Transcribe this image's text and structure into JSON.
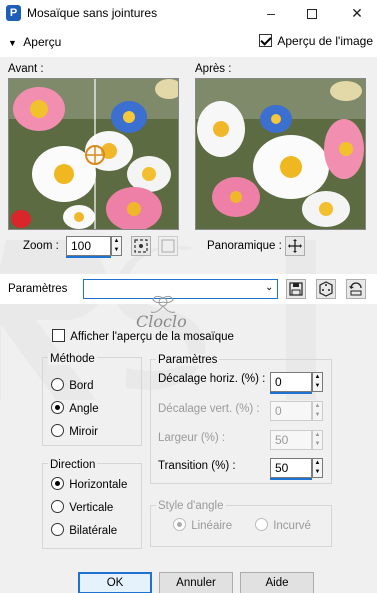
{
  "window": {
    "title": "Mosaïque sans jointures"
  },
  "preview": {
    "toggle_label": "Aperçu",
    "show_image_label": "Aperçu de l'image",
    "show_image_checked": true
  },
  "before": {
    "label": "Avant :"
  },
  "after": {
    "label": "Après :"
  },
  "zoom": {
    "label": "Zoom :",
    "value": "100"
  },
  "pan": {
    "label": "Panoramique :"
  },
  "params_bar": {
    "label": "Paramètres",
    "preset_value": ""
  },
  "watermark": {
    "text": "Cloclo"
  },
  "show_mosaic": {
    "label": "Afficher l'aperçu de la mosaïque",
    "checked": false
  },
  "method": {
    "title": "Méthode",
    "options": [
      {
        "label": "Bord",
        "selected": false
      },
      {
        "label": "Angle",
        "selected": true
      },
      {
        "label": "Miroir",
        "selected": false
      }
    ]
  },
  "direction": {
    "title": "Direction",
    "options": [
      {
        "label": "Horizontale",
        "selected": true
      },
      {
        "label": "Verticale",
        "selected": false
      },
      {
        "label": "Bilatérale",
        "selected": false
      }
    ]
  },
  "parameters": {
    "title": "Paramètres",
    "fields": [
      {
        "label": "Décalage horiz. (%) :",
        "value": "0",
        "enabled": true
      },
      {
        "label": "Décalage vert. (%) :",
        "value": "0",
        "enabled": false
      },
      {
        "label": "Largeur (%) :",
        "value": "50",
        "enabled": false
      },
      {
        "label": "Transition (%) :",
        "value": "50",
        "enabled": true
      }
    ]
  },
  "corner_style": {
    "title": "Style d'angle",
    "options": [
      {
        "label": "Linéaire",
        "selected": true
      },
      {
        "label": "Incurvé",
        "selected": false
      }
    ]
  },
  "buttons": {
    "ok": "OK",
    "cancel": "Annuler",
    "help": "Aide"
  },
  "colors": {
    "accent": "#1e73d2"
  }
}
